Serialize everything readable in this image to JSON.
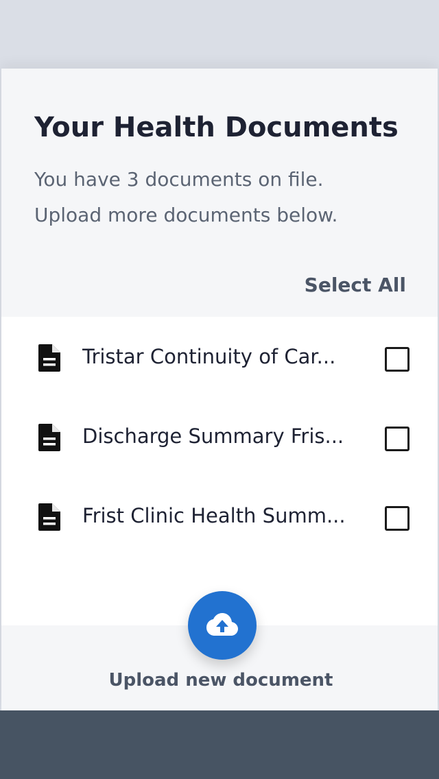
{
  "header": {
    "title": "Your Health Documents",
    "subtitle_line1": "You have 3 documents on file.",
    "subtitle_line2": "Upload more documents below.",
    "select_all_label": "Select All"
  },
  "documents": [
    {
      "name": "Tristar Continuity of Car...",
      "icon": "file-document-icon",
      "checked": false
    },
    {
      "name": "Discharge Summary Fris...",
      "icon": "file-document-icon",
      "checked": false
    },
    {
      "name": "Frist Clinic Health Summ...",
      "icon": "file-document-icon",
      "checked": false
    }
  ],
  "upload": {
    "label": "Upload new document",
    "icon": "cloud-upload-icon"
  },
  "colors": {
    "accent": "#2272d0",
    "title_text": "#1e2233",
    "muted_text": "#5b6473",
    "bottom_bar": "#475463"
  }
}
